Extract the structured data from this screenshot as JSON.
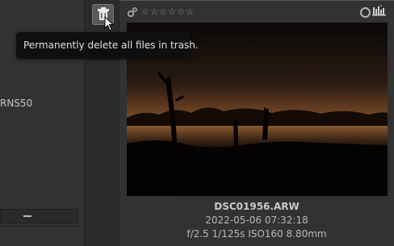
{
  "left_panel": {
    "partial_label": "RNS50",
    "bottom_button_icon": "minus-icon"
  },
  "toolbar": {
    "trash_button_icon": "trash-icon",
    "tooltip": "Permanently delete all files in trash."
  },
  "thumbnail": {
    "gear_icon": "gear-icon",
    "rating_stars": [
      "☆",
      "☆",
      "☆",
      "☆",
      "☆",
      "☆"
    ],
    "rating": 0,
    "color_label_icon": "circle-icon",
    "histogram_icon": "histogram-icon",
    "filename": "DSC01956.ARW",
    "datetime": "2022-05-06 07:32:18",
    "exif": "f/2.5 1/125s ISO160 8.80mm"
  },
  "colors": {
    "background": "#303030",
    "tooltip_bg": "#0f0f0f",
    "text": "#bdbdbd"
  }
}
